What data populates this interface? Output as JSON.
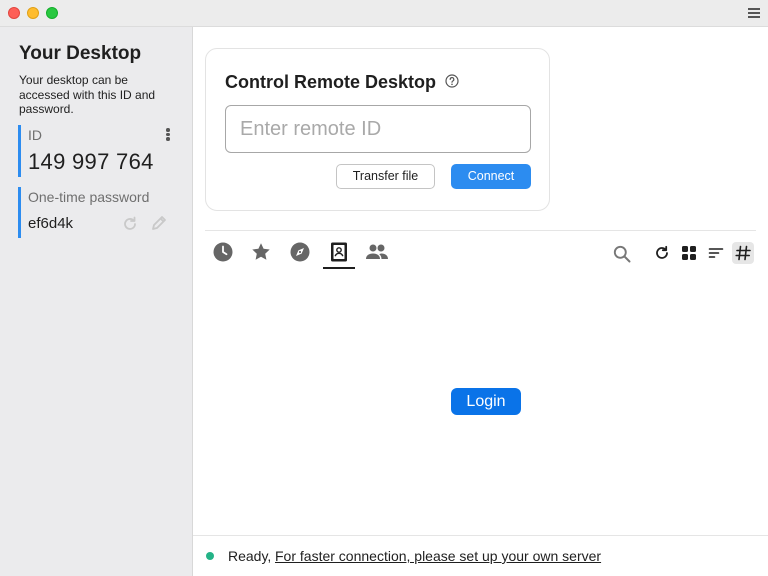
{
  "sidebar": {
    "title": "Your Desktop",
    "description": "Your desktop can be accessed with this ID and password.",
    "id_label": "ID",
    "id_value": "149 997 764",
    "password_label": "One-time password",
    "password_value": "ef6d4k"
  },
  "control": {
    "title": "Control Remote Desktop",
    "input_placeholder": "Enter remote ID",
    "input_value": "",
    "transfer_label": "Transfer file",
    "connect_label": "Connect"
  },
  "tabs": [
    {
      "name": "recent-sessions",
      "icon": "clock-icon"
    },
    {
      "name": "favorites",
      "icon": "star-icon"
    },
    {
      "name": "discovered",
      "icon": "compass-icon"
    },
    {
      "name": "address-book",
      "icon": "address-book-icon",
      "active": true
    },
    {
      "name": "group",
      "icon": "people-icon"
    }
  ],
  "tools": [
    "search-icon",
    "refresh-icon",
    "grid-view-icon",
    "sort-icon",
    "hashtag-icon"
  ],
  "main": {
    "login_label": "Login"
  },
  "status": {
    "ready_text": "Ready,",
    "link_text": "For faster connection, please set up your own server"
  },
  "colors": {
    "accent": "#2c8cf0",
    "login": "#0a73e8",
    "status_ok": "#24b387",
    "sidebar_bg": "#ebebed"
  }
}
